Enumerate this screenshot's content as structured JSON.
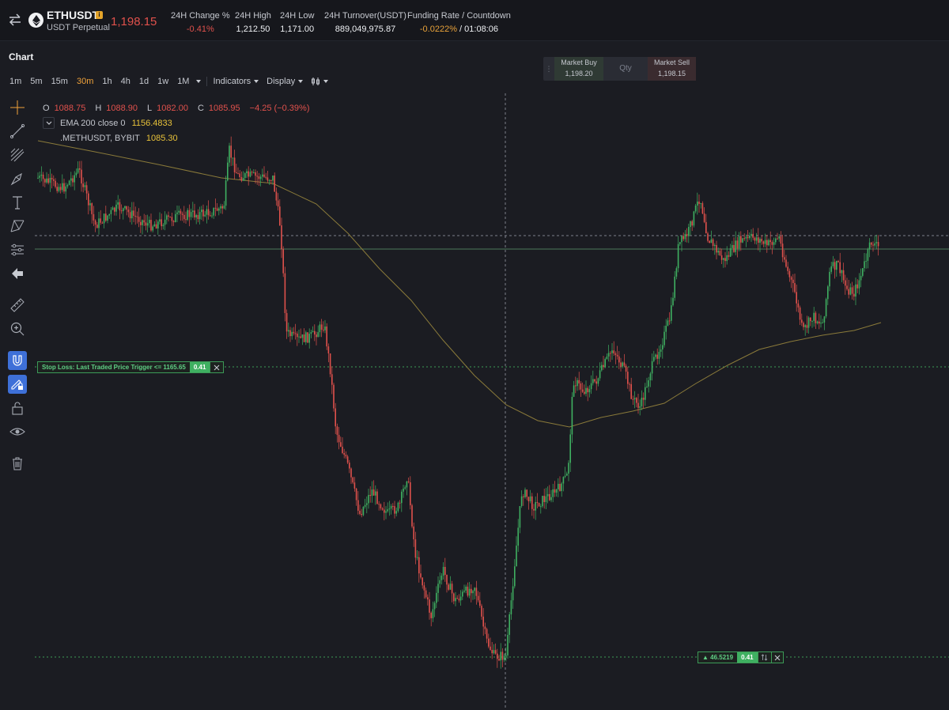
{
  "header": {
    "symbol": "ETHUSDT",
    "info_badge": "i",
    "contract_type": "USDT Perpetual",
    "last_price": "1,198.15",
    "stats": [
      {
        "label": "24H Change %",
        "value": "-0.41%",
        "tone": "neg"
      },
      {
        "label": "24H High",
        "value": "1,212.50",
        "tone": "plain"
      },
      {
        "label": "24H Low",
        "value": "1,171.00",
        "tone": "plain"
      },
      {
        "label": "24H Turnover(USDT)",
        "value": "889,049,975.87",
        "tone": "plain"
      }
    ],
    "funding": {
      "label": "Funding Rate / Countdown",
      "rate": "-0.0222%",
      "countdown": "/ 01:08:06"
    }
  },
  "chart": {
    "title": "Chart",
    "timeframes": [
      "1m",
      "5m",
      "15m",
      "30m",
      "1h",
      "4h",
      "1d",
      "1w",
      "1M"
    ],
    "active_timeframe": "30m",
    "indicators_label": "Indicators",
    "display_label": "Display"
  },
  "order_panel": {
    "buy_label": "Market Buy",
    "buy_price": "1,198.20",
    "qty_placeholder": "Qty",
    "sell_label": "Market Sell",
    "sell_price": "1,198.15"
  },
  "legend": {
    "open_key": "O",
    "open": "1088.75",
    "high_key": "H",
    "high": "1088.90",
    "low_key": "L",
    "low": "1082.00",
    "close_key": "C",
    "close": "1085.95",
    "change": "−4.25 (−0.39%)",
    "ema_name": "EMA 200 close 0",
    "ema_value": "1156.4833",
    "mark_name": ".METHUSDT, BYBIT",
    "mark_value": "1085.30"
  },
  "stop_loss": {
    "text": "Stop Loss: Last Traded Price Trigger <= 1165.65",
    "qty": "0.41"
  },
  "position": {
    "text": "▲ 46.5219",
    "qty": "0.41"
  },
  "colors": {
    "up": "#3fb061",
    "down": "#e0514c",
    "ema": "#8a7a3a",
    "accent": "#f0a23a",
    "tool_active": "#3e70d8"
  },
  "icons": [
    "swap-icon",
    "eth-coin-icon",
    "crosshair-icon",
    "trendline-icon",
    "fib-icon",
    "brush-icon",
    "text-icon",
    "pattern-icon",
    "measure-icon",
    "back-arrow-icon",
    "ruler-icon",
    "zoom-in-icon",
    "magnet-icon",
    "lock-drawing-icon",
    "unlock-icon",
    "eye-icon",
    "trash-icon",
    "close-icon"
  ]
}
